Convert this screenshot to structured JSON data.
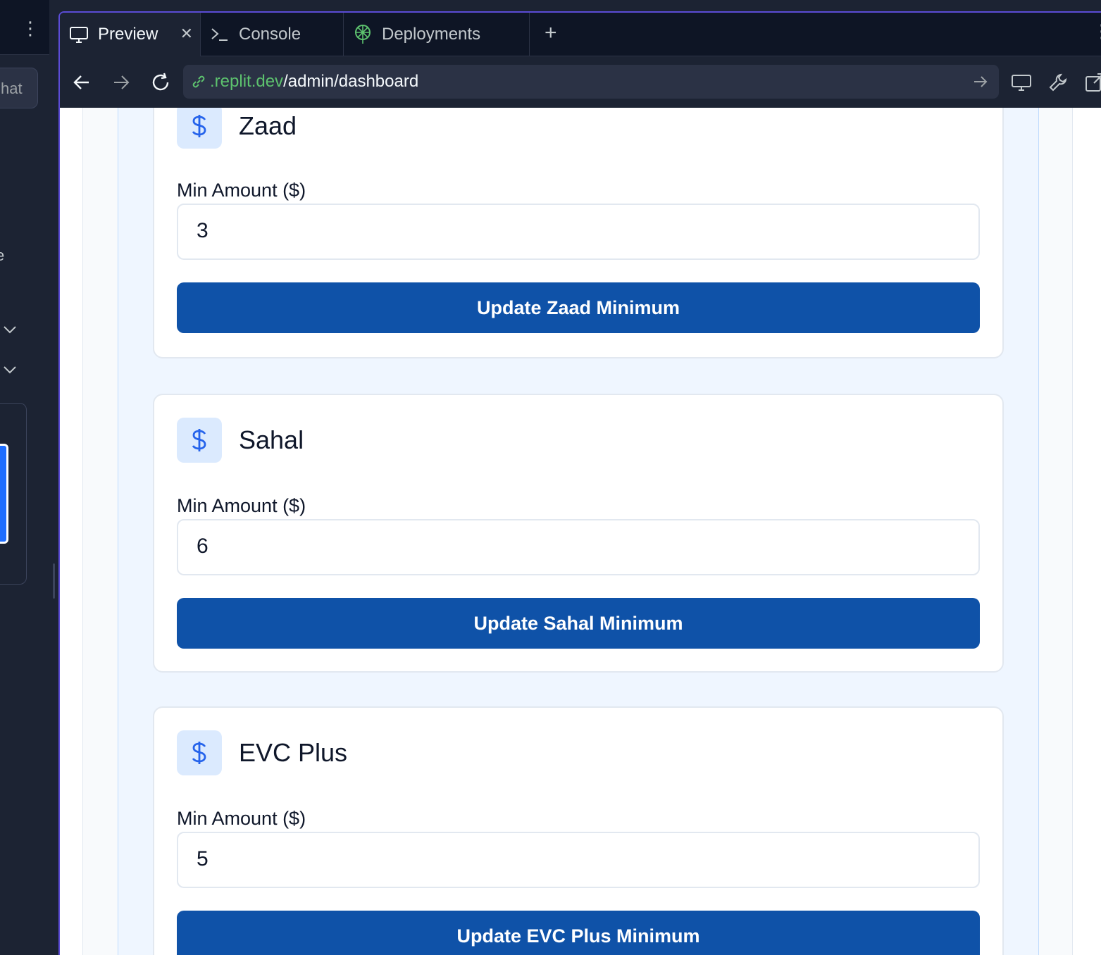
{
  "left_panel": {
    "chat_label": "hat",
    "partial_text": "e"
  },
  "tabs": [
    {
      "label": "Preview",
      "icon": "monitor-icon",
      "active": true
    },
    {
      "label": "Console",
      "icon": "terminal-icon",
      "active": false
    },
    {
      "label": "Deployments",
      "icon": "deployments-icon",
      "active": false
    }
  ],
  "url": {
    "domain": ".replit.dev",
    "path": "/admin/dashboard"
  },
  "cards": [
    {
      "title": "Zaad",
      "min_label": "Min Amount ($)",
      "min_value": "3",
      "button_label": "Update Zaad Minimum"
    },
    {
      "title": "Sahal",
      "min_label": "Min Amount ($)",
      "min_value": "6",
      "button_label": "Update Sahal Minimum"
    },
    {
      "title": "EVC Plus",
      "min_label": "Min Amount ($)",
      "min_value": "5",
      "button_label": "Update EVC Plus Minimum"
    }
  ],
  "colors": {
    "accent_button": "#0f52a8",
    "badge_bg": "#dbeafe",
    "url_domain": "#5dc26e",
    "pane_border": "#5b4cd6"
  }
}
